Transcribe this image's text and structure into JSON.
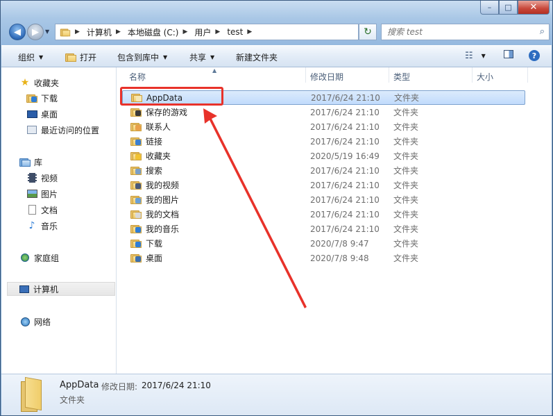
{
  "window": {
    "caption_min": "–",
    "caption_max": "□",
    "caption_close": "✕"
  },
  "address": {
    "crumbs": [
      "计算机",
      "本地磁盘 (C:)",
      "用户",
      "test"
    ],
    "search_placeholder": "搜索 test"
  },
  "toolbar": {
    "organize": "组织",
    "open": "打开",
    "include_library": "包含到库中",
    "share": "共享",
    "new_folder": "新建文件夹"
  },
  "columns": {
    "name": "名称",
    "date": "修改日期",
    "type": "类型",
    "size": "大小"
  },
  "sidebar": {
    "favorites": {
      "label": "收藏夹",
      "items": [
        "下载",
        "桌面",
        "最近访问的位置"
      ]
    },
    "libraries": {
      "label": "库",
      "items": [
        "视频",
        "图片",
        "文档",
        "音乐"
      ]
    },
    "homegroup": "家庭组",
    "computer": "计算机",
    "network": "网络"
  },
  "files": [
    {
      "name": "AppData",
      "date": "2017/6/24 21:10",
      "type": "文件夹",
      "badge": "#f5e7b5"
    },
    {
      "name": "保存的游戏",
      "date": "2017/6/24 21:10",
      "type": "文件夹",
      "badge": "#3a3a3a"
    },
    {
      "name": "联系人",
      "date": "2017/6/24 21:10",
      "type": "文件夹",
      "badge": "#e9a04a"
    },
    {
      "name": "链接",
      "date": "2017/6/24 21:10",
      "type": "文件夹",
      "badge": "#3b7fd0"
    },
    {
      "name": "收藏夹",
      "date": "2020/5/19 16:49",
      "type": "文件夹",
      "badge": "#f1c232"
    },
    {
      "name": "搜索",
      "date": "2017/6/24 21:10",
      "type": "文件夹",
      "badge": "#7a9fc8"
    },
    {
      "name": "我的视频",
      "date": "2017/6/24 21:10",
      "type": "文件夹",
      "badge": "#4a5a7a"
    },
    {
      "name": "我的图片",
      "date": "2017/6/24 21:10",
      "type": "文件夹",
      "badge": "#6aa0d8"
    },
    {
      "name": "我的文档",
      "date": "2017/6/24 21:10",
      "type": "文件夹",
      "badge": "#d9d9d9"
    },
    {
      "name": "我的音乐",
      "date": "2017/6/24 21:10",
      "type": "文件夹",
      "badge": "#2f7dd6"
    },
    {
      "name": "下载",
      "date": "2020/7/8 9:47",
      "type": "文件夹",
      "badge": "#2f7dd6"
    },
    {
      "name": "桌面",
      "date": "2020/7/8 9:48",
      "type": "文件夹",
      "badge": "#3c6fb0"
    }
  ],
  "details": {
    "name": "AppData",
    "modified_label": "修改日期:",
    "modified_value": "2017/6/24 21:10",
    "type": "文件夹"
  },
  "colors": {
    "annotation": "#e8322a",
    "selection": "#c1dbfc"
  }
}
